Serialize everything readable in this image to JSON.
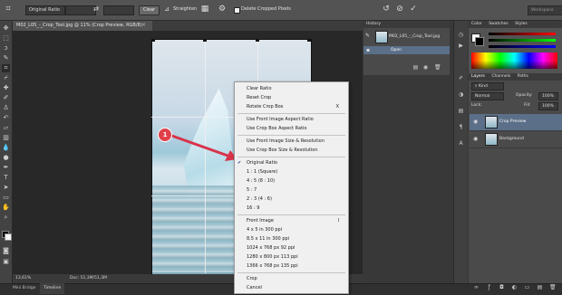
{
  "options_bar": {
    "ratio_select": "Original Ratio",
    "clear_label": "Clear",
    "straighten_label": "Straighten",
    "delete_cropped_label": "Delete Cropped Pixels",
    "workspace": "Workspace"
  },
  "document": {
    "tab_title": "M02_L05_-_Crop_Tool.jpg @ 11% (Crop Preview, RGB/8)",
    "zoom": "13,61%",
    "doc_size": "Doc: 51,3M/51,3M",
    "callout_number": "1"
  },
  "bottom_tabs": [
    "Mini Bridge",
    "Timeline"
  ],
  "history": {
    "tab": "History",
    "snapshot": "M02_L05_-_Crop_Tool.jpg",
    "step": "Open"
  },
  "color_panel": {
    "tabs": [
      "Color",
      "Swatches",
      "Styles"
    ]
  },
  "layers_panel": {
    "tabs": [
      "Layers",
      "Channels",
      "Paths"
    ],
    "kind": "Kind",
    "blend_mode": "Normal",
    "opacity_label": "Opacity:",
    "opacity_value": "100%",
    "lock_label": "Lock:",
    "fill_label": "Fill:",
    "fill_value": "100%",
    "layers": [
      {
        "name": "Crop Preview",
        "selected": true
      },
      {
        "name": "Background",
        "selected": false
      }
    ]
  },
  "context_menu": {
    "items": [
      {
        "label": "Clear Ratio"
      },
      {
        "label": "Reset Crop"
      },
      {
        "label": "Rotate Crop Box",
        "shortcut": "X"
      },
      {
        "label": "Use Front Image Aspect Ratio"
      },
      {
        "label": "Use Crop Box Aspect Ratio"
      },
      {
        "label": "Use Front Image Size & Resolution"
      },
      {
        "label": "Use Crop Box Size & Resolution"
      },
      {
        "label": "Original Ratio",
        "checked": true
      },
      {
        "label": "1 : 1 (Square)"
      },
      {
        "label": "4 : 5 (8 : 10)"
      },
      {
        "label": "5 : 7"
      },
      {
        "label": "2 : 3 (4 : 6)"
      },
      {
        "label": "16 : 9"
      },
      {
        "label": "Front Image",
        "shortcut": "I"
      },
      {
        "label": "4 x 5 in 300 ppi"
      },
      {
        "label": "8,5 x 11 in 300 ppi"
      },
      {
        "label": "1024 x 768 px 92 ppi"
      },
      {
        "label": "1280 x 800 px 113 ppi"
      },
      {
        "label": "1366 x 768 px 135 ppi"
      },
      {
        "label": "Crop"
      },
      {
        "label": "Cancel"
      }
    ]
  },
  "colors": {
    "accent_selection": "#5b6f88",
    "callout": "#e0404a",
    "callout_arrow": "#d9334a"
  }
}
